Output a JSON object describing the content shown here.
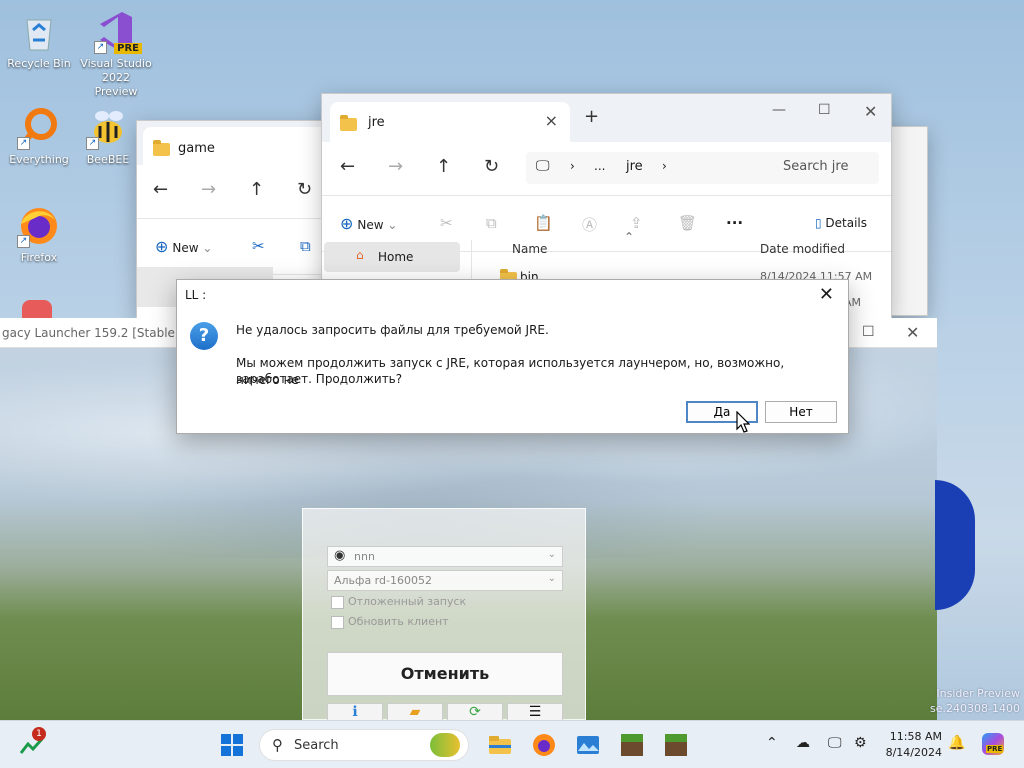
{
  "desktop": {
    "icons": [
      {
        "label": "Recycle Bin"
      },
      {
        "label": "Visual Studio 2022 Preview",
        "badge": "PRE"
      },
      {
        "label": "Everything"
      },
      {
        "label": "BeeBEE"
      },
      {
        "label": "Firefox"
      }
    ]
  },
  "window_game": {
    "tab_title": "game",
    "new_label": "New"
  },
  "window_jre": {
    "tab_title": "jre",
    "breadcrumb": [
      "...",
      "jre"
    ],
    "search_placeholder": "Search jre",
    "new_label": "New",
    "details_label": "Details",
    "nav_home": "Home",
    "col_name": "Name",
    "col_date": "Date modified",
    "rows": [
      {
        "name": "bin",
        "date": "8/14/2024 11:57 AM"
      },
      {
        "name": "",
        "date": "AM"
      }
    ]
  },
  "dialog": {
    "title": "LL :",
    "line1": "Не удалось запросить файлы для требуемой JRE.",
    "line2": "Мы можем продолжить запуск с JRE, которая используется лаунчером, но, возможно, ничего не",
    "line3": "заработает. Продолжить?",
    "yes": "Да",
    "no": "Нет"
  },
  "launcher": {
    "title": "gacy Launcher 159.2 [Stable]",
    "account": "nnn",
    "version": "Альфа rd-160052",
    "deferred": "Отложенный запуск",
    "update": "Обновить клиент",
    "cancel": "Отменить"
  },
  "watermark": {
    "line1": "Insider Preview",
    "line2": "se.240308-1400"
  },
  "taskbar": {
    "search": "Search",
    "notif_count": "1",
    "time": "11:58 AM",
    "date": "8/14/2024",
    "copilot_badge": "PRE"
  }
}
